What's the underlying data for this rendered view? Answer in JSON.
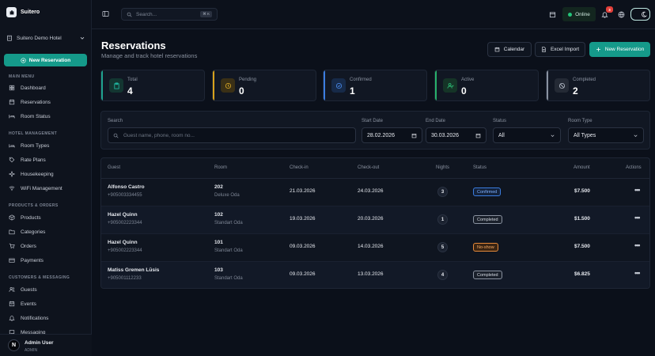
{
  "app": {
    "brand": "Suitero"
  },
  "sidebar": {
    "hotel": "Suitero Demo Hotel",
    "new_button": "New Reservation",
    "sections": [
      {
        "title": "MAIN MENU",
        "items": [
          "Dashboard",
          "Reservations",
          "Room Status"
        ]
      },
      {
        "title": "HOTEL MANAGEMENT",
        "items": [
          "Room Types",
          "Rate Plans",
          "Housekeeping",
          "WiFi Management"
        ]
      },
      {
        "title": "PRODUCTS & ORDERS",
        "items": [
          "Products",
          "Categories",
          "Orders",
          "Payments"
        ]
      },
      {
        "title": "CUSTOMERS & MESSAGING",
        "items": [
          "Guests",
          "Events",
          "Notifications",
          "Messaging"
        ]
      }
    ],
    "user": {
      "initial": "N",
      "name": "Admin User",
      "role": "ADMIN"
    }
  },
  "topbar": {
    "search_placeholder": "Search...",
    "shortcut": "⌘ K",
    "status": "Online",
    "notif_count": "3"
  },
  "page": {
    "title": "Reservations",
    "subtitle": "Manage and track hotel reservations",
    "buttons": {
      "calendar": "Calendar",
      "excel": "Excel Import",
      "new": "New Reservation"
    }
  },
  "stats": [
    {
      "label": "Total",
      "value": "4",
      "color": "#1fa38f"
    },
    {
      "label": "Pending",
      "value": "0",
      "color": "#d8a21c"
    },
    {
      "label": "Confirmed",
      "value": "1",
      "color": "#3b7de0"
    },
    {
      "label": "Active",
      "value": "0",
      "color": "#27b16a"
    },
    {
      "label": "Completed",
      "value": "2",
      "color": "#8a92a0"
    }
  ],
  "filters": {
    "search_label": "Search",
    "search_placeholder": "Guest name, phone, room no...",
    "start_label": "Start Date",
    "start_value": "28.02.2026",
    "end_label": "End Date",
    "end_value": "30.03.2026",
    "status_label": "Status",
    "status_value": "All",
    "roomtype_label": "Room Type",
    "roomtype_value": "All Types"
  },
  "table": {
    "headers": [
      "Guest",
      "Room",
      "Check-in",
      "Check-out",
      "Nights",
      "Status",
      "Amount",
      "Actions"
    ],
    "rows": [
      {
        "guest": "Alfonso Castro",
        "phone": "+905003334455",
        "room": "202",
        "roomtype": "Deluxe Oda",
        "checkin": "21.03.2026",
        "checkout": "24.03.2026",
        "nights": "3",
        "status": "Confirmed",
        "amount": "$7.500"
      },
      {
        "guest": "Hazel Quinn",
        "phone": "+905002223344",
        "room": "102",
        "roomtype": "Standart Oda",
        "checkin": "19.03.2026",
        "checkout": "20.03.2026",
        "nights": "1",
        "status": "Completed",
        "amount": "$1.500"
      },
      {
        "guest": "Hazel Quinn",
        "phone": "+905002223344",
        "room": "101",
        "roomtype": "Standart Oda",
        "checkin": "09.03.2026",
        "checkout": "14.03.2026",
        "nights": "5",
        "status": "No-show",
        "amount": "$7.500"
      },
      {
        "guest": "Matiss Gremen Lūsis",
        "phone": "+905001112233",
        "room": "103",
        "roomtype": "Standart Oda",
        "checkin": "09.03.2026",
        "checkout": "13.03.2026",
        "nights": "4",
        "status": "Completed",
        "amount": "$6.825"
      }
    ],
    "actions_glyph": "•••"
  },
  "status_colors": {
    "Confirmed": "#3b7de0",
    "Completed": "#b9c0cc",
    "No-show": "#e68a3a"
  }
}
